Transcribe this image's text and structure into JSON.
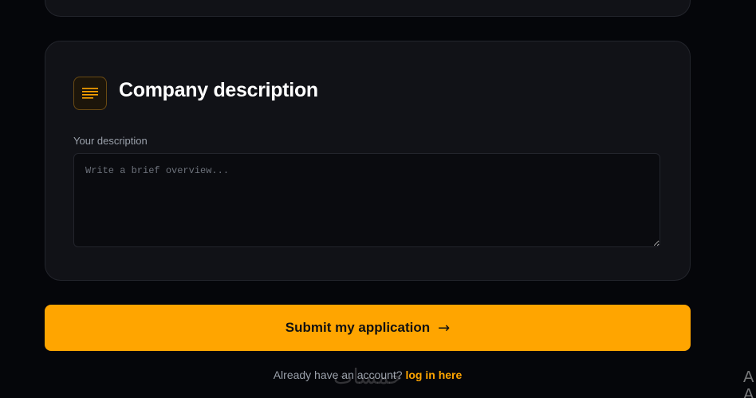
{
  "section": {
    "title": "Company description",
    "icon": "lines-icon",
    "accent": "#ffa500"
  },
  "description_field": {
    "label": "Your description",
    "placeholder": "Write a brief overview...",
    "value": ""
  },
  "submit": {
    "label": "Submit my application",
    "arrow": "→",
    "color": "#ffa500"
  },
  "footer": {
    "prompt": "Already have an account?",
    "link": "log in here"
  },
  "watermark": "خمسات",
  "edge_text": "A\nA"
}
